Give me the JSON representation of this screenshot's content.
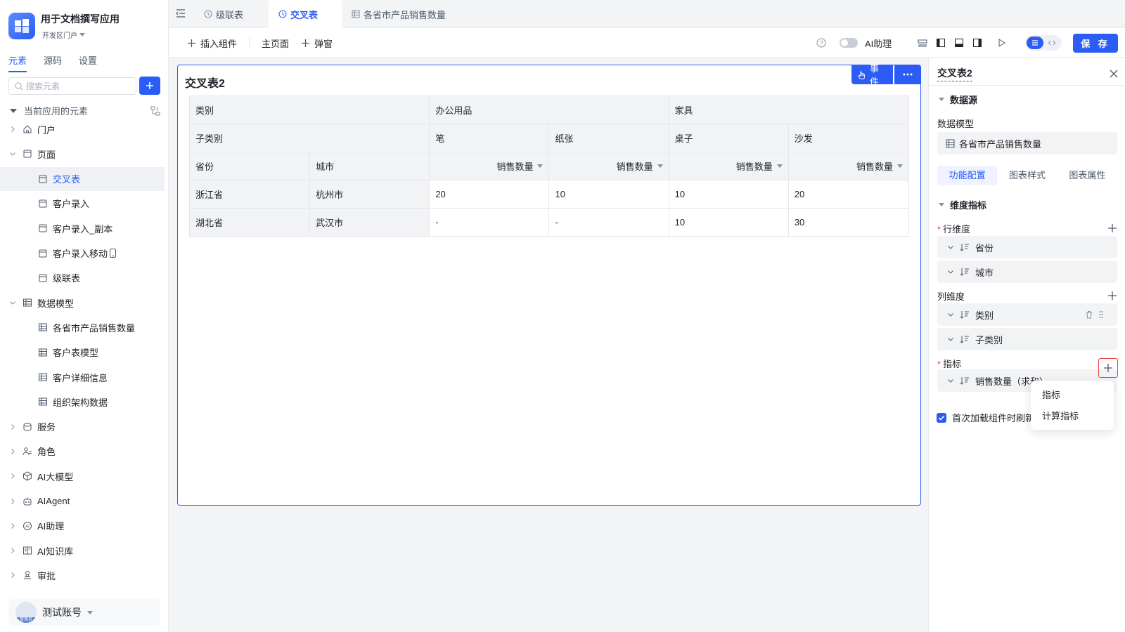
{
  "app": {
    "title": "用于文档撰写应用",
    "subtitle": "开发区门户"
  },
  "sidebar": {
    "tabs": [
      "元素",
      "源码",
      "设置"
    ],
    "search_placeholder": "搜索元素",
    "tree_header": "当前应用的元素",
    "items": [
      {
        "label": "门户",
        "icon": "home-icon"
      },
      {
        "label": "页面",
        "icon": "page-icon"
      },
      {
        "label": "交叉表",
        "icon": "page-icon"
      },
      {
        "label": "客户录入",
        "icon": "page-icon"
      },
      {
        "label": "客户录入_副本",
        "icon": "page-icon"
      },
      {
        "label": "客户录入移动",
        "icon": "page-icon"
      },
      {
        "label": "级联表",
        "icon": "page-icon"
      },
      {
        "label": "数据模型",
        "icon": "table-icon"
      },
      {
        "label": "各省市产品销售数量",
        "icon": "table-icon"
      },
      {
        "label": "客户表模型",
        "icon": "table-icon"
      },
      {
        "label": "客户详细信息",
        "icon": "table-icon"
      },
      {
        "label": "组织架构数据",
        "icon": "table-icon"
      },
      {
        "label": "服务",
        "icon": "service-icon"
      },
      {
        "label": "角色",
        "icon": "role-icon"
      },
      {
        "label": "AI大模型",
        "icon": "model-icon"
      },
      {
        "label": "AIAgent",
        "icon": "robot-icon"
      },
      {
        "label": "AI助理",
        "icon": "ai-assistant-icon"
      },
      {
        "label": "AI知识库",
        "icon": "book-icon"
      },
      {
        "label": "审批",
        "icon": "approval-icon"
      }
    ],
    "user": {
      "name": "测试账号",
      "badge": "管理员"
    }
  },
  "top_tabs": [
    "级联表",
    "交叉表",
    "各省市产品销售数量"
  ],
  "toolbar": {
    "insert": "插入组件",
    "home": "主页面",
    "popup": "弹窗",
    "ai": "AI助理",
    "save": "保 存"
  },
  "card": {
    "title": "交叉表2",
    "event_btn": "事件",
    "table": {
      "row1": [
        "类别",
        "办公用品",
        "家具"
      ],
      "row2": [
        "子类别",
        "笔",
        "纸张",
        "桌子",
        "沙发"
      ],
      "row3": [
        "省份",
        "城市",
        "销售数量",
        "销售数量",
        "销售数量",
        "销售数量"
      ],
      "data": [
        [
          "浙江省",
          "杭州市",
          "20",
          "10",
          "10",
          "20"
        ],
        [
          "湖北省",
          "武汉市",
          "-",
          "-",
          "10",
          "30"
        ]
      ]
    }
  },
  "panel": {
    "title": "交叉表2",
    "datasource": "数据源",
    "data_model_label": "数据模型",
    "data_model_value": "各省市产品销售数量",
    "tabs": [
      "功能配置",
      "图表样式",
      "图表属性"
    ],
    "dim_section": "维度指标",
    "row_dim_label": "行维度",
    "row_dims": [
      "省份",
      "城市"
    ],
    "col_dim_label": "列维度",
    "col_dims": [
      "类别",
      "子类别"
    ],
    "metric_label": "指标",
    "metric_value": "销售数量（求和）",
    "checkbox_label": "首次加载组件时刷新",
    "dropdown": [
      "指标",
      "计算指标"
    ]
  },
  "colors": {
    "accent": "#2b5cf5",
    "danger": "#f53f3f"
  }
}
